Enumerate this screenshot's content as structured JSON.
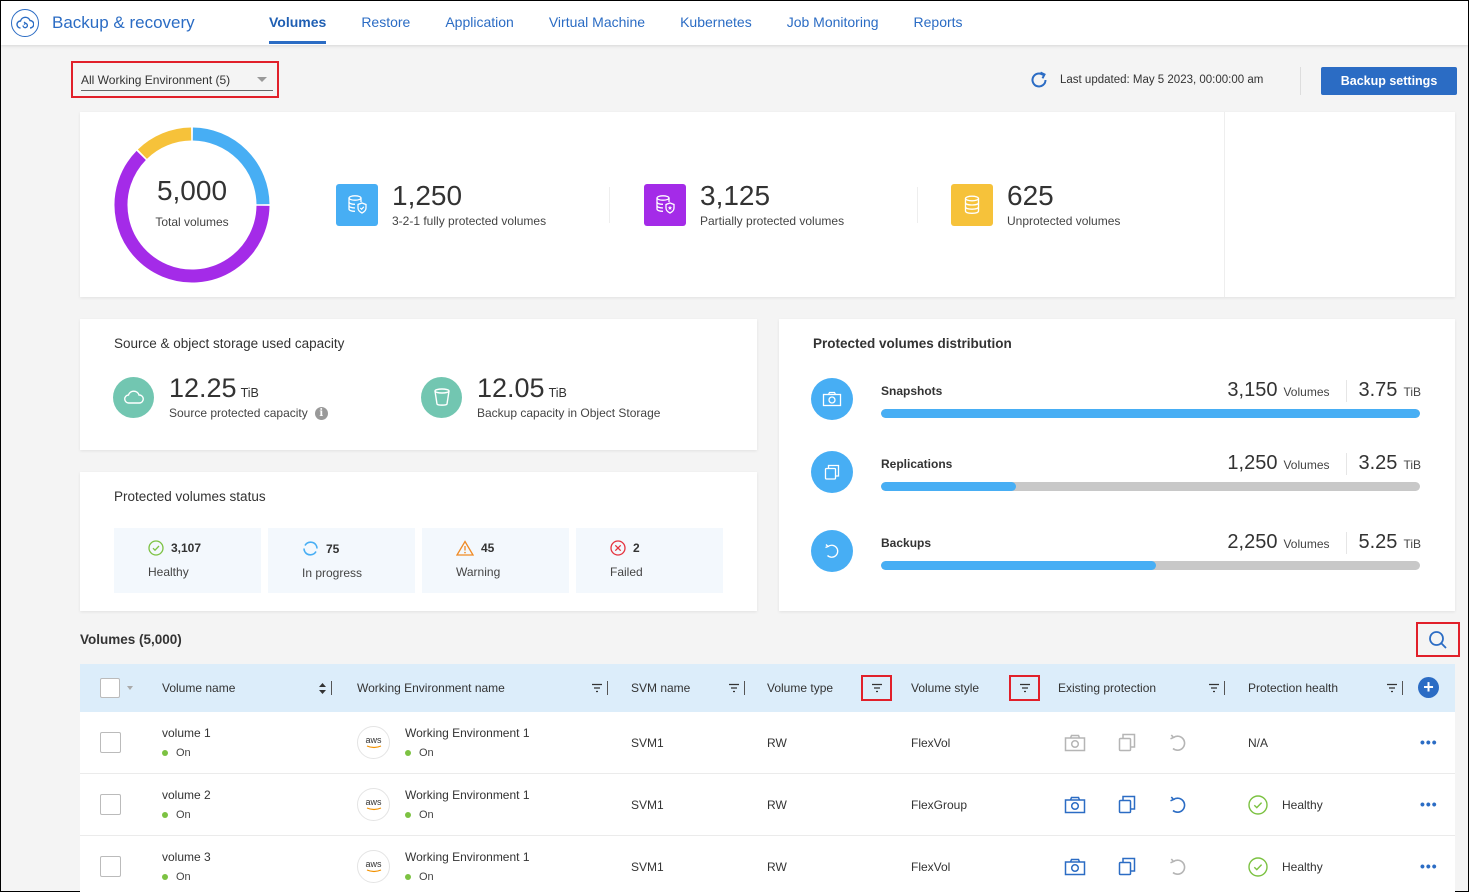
{
  "app": {
    "title": "Backup & recovery",
    "nav": [
      {
        "label": "Volumes",
        "active": true
      },
      {
        "label": "Restore",
        "active": false
      },
      {
        "label": "Application",
        "active": false
      },
      {
        "label": "Virtual Machine",
        "active": false
      },
      {
        "label": "Kubernetes",
        "active": false
      },
      {
        "label": "Job Monitoring",
        "active": false
      },
      {
        "label": "Reports",
        "active": false
      }
    ]
  },
  "toolbar": {
    "working_environment_select": "All Working Environment (5)",
    "last_updated": "Last updated: May 5 2023, 00:00:00 am",
    "backup_settings_label": "Backup settings"
  },
  "summary": {
    "total": {
      "value": "5,000",
      "label": "Total volumes"
    },
    "donut": {
      "total": 5000,
      "segments": [
        {
          "name": "3-2-1 fully protected",
          "value": 1250,
          "color": "#47aef4"
        },
        {
          "name": "Partially protected",
          "value": 3125,
          "color": "#a42be8"
        },
        {
          "name": "Unprotected",
          "value": 625,
          "color": "#f6c23a"
        }
      ]
    },
    "stats": [
      {
        "value": "1,250",
        "label": "3-2-1 fully protected volumes",
        "color": "#47aef4",
        "icon": "database-shield-check-icon"
      },
      {
        "value": "3,125",
        "label": "Partially protected volumes",
        "color": "#a42be8",
        "icon": "database-shield-star-icon"
      },
      {
        "value": "625",
        "label": "Unprotected volumes",
        "color": "#f6c23a",
        "icon": "database-icon"
      }
    ]
  },
  "capacity": {
    "title": "Source & object storage used capacity",
    "items": [
      {
        "value": "12.25",
        "unit": "TiB",
        "label": "Source protected capacity",
        "icon": "cloud-icon",
        "has_info": true
      },
      {
        "value": "12.05",
        "unit": "TiB",
        "label": "Backup capacity in Object Storage",
        "icon": "bucket-icon",
        "has_info": false
      }
    ]
  },
  "status": {
    "title": "Protected volumes status",
    "tiles": [
      {
        "count": "3,107",
        "label": "Healthy",
        "icon": "check-circle-icon",
        "color": "#7cc242"
      },
      {
        "count": "75",
        "label": "In progress",
        "icon": "progress-icon",
        "color": "#47aef4"
      },
      {
        "count": "45",
        "label": "Warning",
        "icon": "warning-icon",
        "color": "#f08a24"
      },
      {
        "count": "2",
        "label": "Failed",
        "icon": "x-circle-icon",
        "color": "#e5323e"
      }
    ]
  },
  "distribution": {
    "title": "Protected volumes distribution",
    "rows": [
      {
        "name": "Snapshots",
        "volumes": "3,150",
        "volumes_unit": "Volumes",
        "capacity": "3.75",
        "capacity_unit": "TiB",
        "fill": 1.0,
        "icon": "camera-icon"
      },
      {
        "name": "Replications",
        "volumes": "1,250",
        "volumes_unit": "Volumes",
        "capacity": "3.25",
        "capacity_unit": "TiB",
        "fill": 0.25,
        "icon": "copy-icon"
      },
      {
        "name": "Backups",
        "volumes": "2,250",
        "volumes_unit": "Volumes",
        "capacity": "5.25",
        "capacity_unit": "TiB",
        "fill": 0.51,
        "icon": "backup-icon"
      }
    ]
  },
  "volumes": {
    "title": "Volumes (5,000)",
    "columns": [
      "Volume name",
      "Working Environment name",
      "SVM name",
      "Volume type",
      "Volume style",
      "Existing protection",
      "Protection health"
    ],
    "rows": [
      {
        "name": "volume 1",
        "state": "On",
        "we_provider": "aws",
        "we_name": "Working Environment 1",
        "we_state": "On",
        "svm": "SVM1",
        "type": "RW",
        "style": "FlexVol",
        "snapshot": false,
        "replication": false,
        "backup": false,
        "health": "N/A"
      },
      {
        "name": "volume 2",
        "state": "On",
        "we_provider": "aws",
        "we_name": "Working Environment 1",
        "we_state": "On",
        "svm": "SVM1",
        "type": "RW",
        "style": "FlexGroup",
        "snapshot": true,
        "replication": true,
        "backup": true,
        "health": "Healthy"
      },
      {
        "name": "volume 3",
        "state": "On",
        "we_provider": "aws",
        "we_name": "Working Environment 1",
        "we_state": "On",
        "svm": "SVM1",
        "type": "RW",
        "style": "FlexVol",
        "snapshot": true,
        "replication": true,
        "backup": false,
        "health": "Healthy"
      }
    ]
  },
  "colors": {
    "brand": "#2b6cc4",
    "active_icon": "#2b6cc4",
    "inactive_icon": "#b5b5b5",
    "healthy": "#7cc242"
  }
}
